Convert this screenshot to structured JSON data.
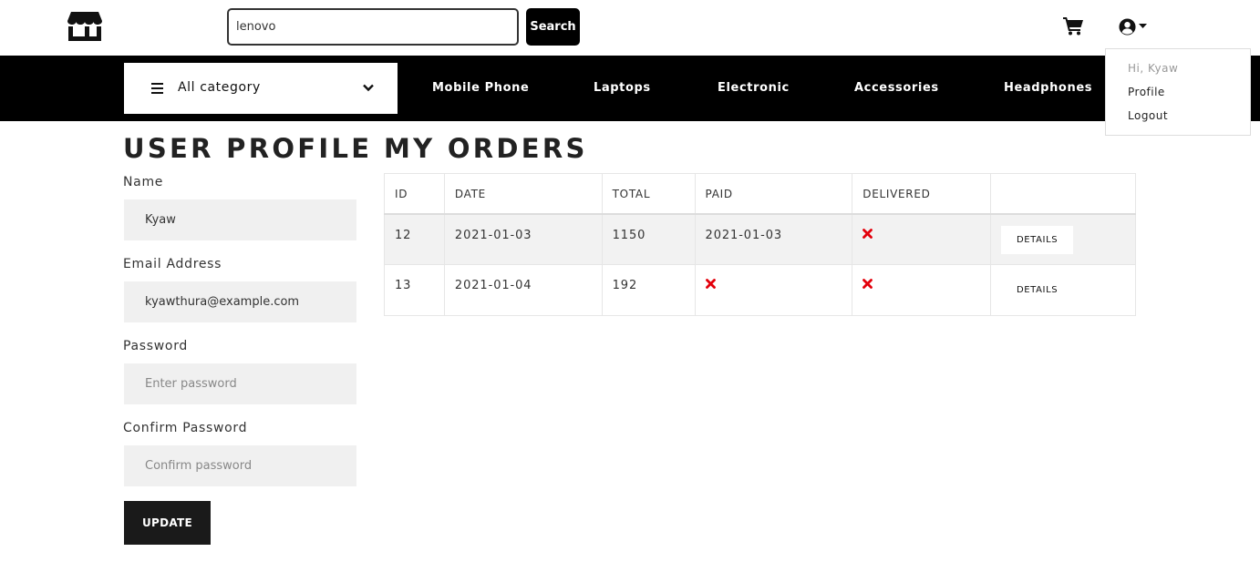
{
  "header": {
    "logo_icon": "store-icon",
    "search": {
      "value": "lenovo",
      "placeholder": "Search",
      "button_label": "Search"
    },
    "cart_icon": "shopping-cart-icon",
    "user_icon": "user-circle-icon"
  },
  "nav": {
    "category_label": "All category",
    "links": [
      "Mobile Phone",
      "Laptops",
      "Electronic",
      "Accessories",
      "Headphones"
    ]
  },
  "user_menu": {
    "greeting": "Hi, Kyaw",
    "items": [
      "Profile",
      "Logout"
    ]
  },
  "profile": {
    "title": "USER PROFILE",
    "name_label": "Name",
    "name_value": "Kyaw",
    "email_label": "Email Address",
    "email_value": "kyawthura@example.com",
    "password_label": "Password",
    "password_placeholder": "Enter password",
    "confirm_label": "Confirm Password",
    "confirm_placeholder": "Confirm password",
    "update_label": "UPDATE"
  },
  "orders": {
    "title": "MY ORDERS",
    "columns": [
      "ID",
      "DATE",
      "TOTAL",
      "PAID",
      "DELIVERED",
      ""
    ],
    "rows": [
      {
        "id": "12",
        "date": "2021-01-03",
        "total": "1150",
        "paid": "2021-01-03",
        "delivered": false,
        "action": "DETAILS"
      },
      {
        "id": "13",
        "date": "2021-01-04",
        "total": "192",
        "paid": false,
        "delivered": false,
        "action": "DETAILS"
      }
    ]
  },
  "colors": {
    "accent": "#000000",
    "not_done": "#e3000b",
    "stripe": "#f2f2f2"
  }
}
